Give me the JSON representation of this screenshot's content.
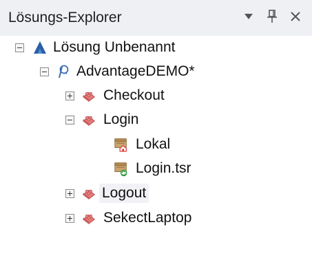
{
  "panel": {
    "title": "Lösungs-Explorer"
  },
  "tree": {
    "solution": {
      "label": "Lösung Unbenannt"
    },
    "project": {
      "label": "AdvantageDEMO*"
    },
    "items": {
      "checkout": {
        "label": "Checkout"
      },
      "login": {
        "label": "Login"
      },
      "lokal": {
        "label": "Lokal"
      },
      "login_tsr": {
        "label": "Login.tsr"
      },
      "logout": {
        "label": "Logout"
      },
      "sekectlaptop": {
        "label": "SekectLaptop"
      }
    }
  },
  "icons": {
    "dropdown": "caret-down-icon",
    "pin": "pin-icon",
    "close": "close-icon",
    "solution": "solution-icon",
    "project": "project-icon",
    "action": "action-icon",
    "repository_local": "local-repository-icon",
    "repository_shared": "shared-repository-icon"
  },
  "colors": {
    "header_bg": "#eef0f4",
    "action_icon": "#e06a6a",
    "solution_icon": "#2a5fa8"
  }
}
